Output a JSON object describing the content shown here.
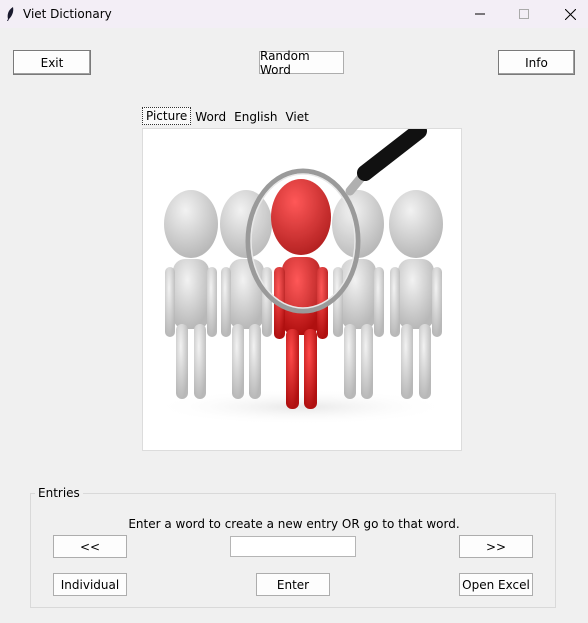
{
  "window": {
    "title": "Viet Dictionary",
    "minimize_symbol": "—",
    "maximize_symbol": "□",
    "close_symbol": "✕"
  },
  "top_buttons": {
    "exit": "Exit",
    "random_word": "Random Word",
    "info": "Info"
  },
  "tabs": [
    {
      "label": "Picture",
      "selected": true
    },
    {
      "label": "Word",
      "selected": false
    },
    {
      "label": "English",
      "selected": false
    },
    {
      "label": "Viet",
      "selected": false
    }
  ],
  "picture": {
    "icon": "magnifier-over-red-figure-illustration",
    "colors": {
      "highlight": "#d81f26",
      "figure": "#cfcfcf"
    }
  },
  "entries": {
    "label": "Entries",
    "instruction": "Enter a word to create a new entry OR go to that word.",
    "prev_label": "<<",
    "next_label": ">>",
    "input_value": "",
    "individual_label": "Individual",
    "enter_label": "Enter",
    "open_excel_label": "Open Excel"
  }
}
